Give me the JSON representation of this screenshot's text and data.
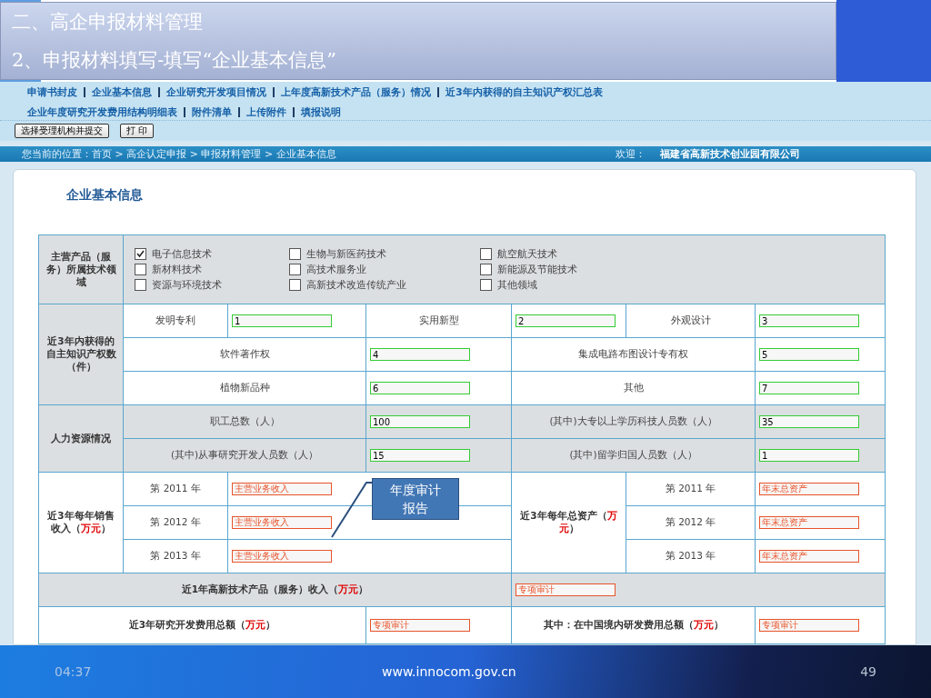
{
  "slide": {
    "heading": "二、高企申报材料管理",
    "subheading": "2、申报材料填写-填写“企业基本信息”"
  },
  "nav_rows": [
    {
      "links": [
        "申请书封皮",
        "企业基本信息",
        "企业研究开发项目情况",
        "上年度高新技术产品（服务）情况",
        "近3年内获得的自主知识产权汇总表"
      ]
    },
    {
      "links": [
        "企业年度研究开发费用结构明细表",
        "附件清单",
        "上传附件",
        "填报说明"
      ]
    }
  ],
  "buttons": [
    "选择受理机构并提交",
    "打 印"
  ],
  "breadcrumb": {
    "path": "您当前的位置：首页 > 高企认定申报 > 申报材料管理 > 企业基本信息",
    "welcome": "欢迎：",
    "company": "福建省高新技术创业园有限公司"
  },
  "card_title": "企业基本信息",
  "tech_fields": {
    "label": "主营产品（服务）所属技术领域",
    "options": [
      {
        "label": "电子信息技术",
        "checked": true
      },
      {
        "label": "生物与新医药技术",
        "checked": false
      },
      {
        "label": "航空航天技术",
        "checked": false
      },
      {
        "label": "新材料技术",
        "checked": false
      },
      {
        "label": "高技术服务业",
        "checked": false
      },
      {
        "label": "新能源及节能技术",
        "checked": false
      },
      {
        "label": "资源与环境技术",
        "checked": false
      },
      {
        "label": "高新技术改造传统产业",
        "checked": false
      },
      {
        "label": "其他领域",
        "checked": false
      }
    ]
  },
  "ip": {
    "label": "近3年内获得的自主知识产权数（件）",
    "items": [
      {
        "label": "发明专利",
        "field": {
          "value": "1",
          "kind": "number"
        }
      },
      {
        "label": "实用新型",
        "field": {
          "value": "2",
          "kind": "number"
        }
      },
      {
        "label": "外观设计",
        "field": {
          "value": "3",
          "kind": "number"
        }
      },
      {
        "label": "软件著作权",
        "field": {
          "value": "4",
          "kind": "number"
        }
      },
      {
        "label": "集成电路布图设计专有权",
        "field": {
          "value": "5",
          "kind": "number"
        }
      },
      {
        "label": "植物新品种",
        "field": {
          "value": "6",
          "kind": "number"
        }
      },
      {
        "label": "其他",
        "field": {
          "value": "7",
          "kind": "number"
        }
      }
    ]
  },
  "hr": {
    "label": "人力资源情况",
    "items": [
      {
        "label": "职工总数（人）",
        "field": {
          "value": "100",
          "kind": "number"
        }
      },
      {
        "label": "(其中)大专以上学历科技人员数（人）",
        "field": {
          "value": "35",
          "kind": "number"
        }
      },
      {
        "label": "(其中)从事研究开发人员数（人）",
        "field": {
          "value": "15",
          "kind": "number"
        }
      },
      {
        "label": "(其中)留学归国人员数（人）",
        "field": {
          "value": "1",
          "kind": "number"
        }
      }
    ]
  },
  "sales": {
    "label": "近3年每年销售收入（**万元**）",
    "years": [
      {
        "label": "第 2011 年",
        "field": {
          "value": "主营业务收入",
          "kind": "audit"
        }
      },
      {
        "label": "第 2012 年",
        "field": {
          "value": "主营业务收入",
          "kind": "audit"
        }
      },
      {
        "label": "第 2013 年",
        "field": {
          "value": "主营业务收入",
          "kind": "audit"
        }
      }
    ]
  },
  "assets": {
    "label": "近3年每年总资产（**万元**）",
    "years": [
      {
        "label": "第 2011 年",
        "field": {
          "value": "年末总资产",
          "kind": "audit"
        }
      },
      {
        "label": "第 2012 年",
        "field": {
          "value": "年末总资产",
          "kind": "audit"
        }
      },
      {
        "label": "第 2013 年",
        "field": {
          "value": "年末总资产",
          "kind": "audit"
        }
      }
    ]
  },
  "hitech_income": {
    "label": "近1年高新技术产品（服务）收入（**万元**）",
    "field": {
      "value": "专项审计",
      "kind": "audit"
    }
  },
  "rd": {
    "label": "近3年研究开发费用总额（**万元**）",
    "field": {
      "value": "专项审计",
      "kind": "audit"
    },
    "domestic_label": "其中：在中国境内研发费用总额（**万元**）",
    "domestic_field": {
      "value": "专项审计",
      "kind": "audit"
    }
  },
  "callout": "年度审计报告",
  "footer": {
    "time": "04:37",
    "url": "www.innocom.gov.cn",
    "page": "49"
  }
}
